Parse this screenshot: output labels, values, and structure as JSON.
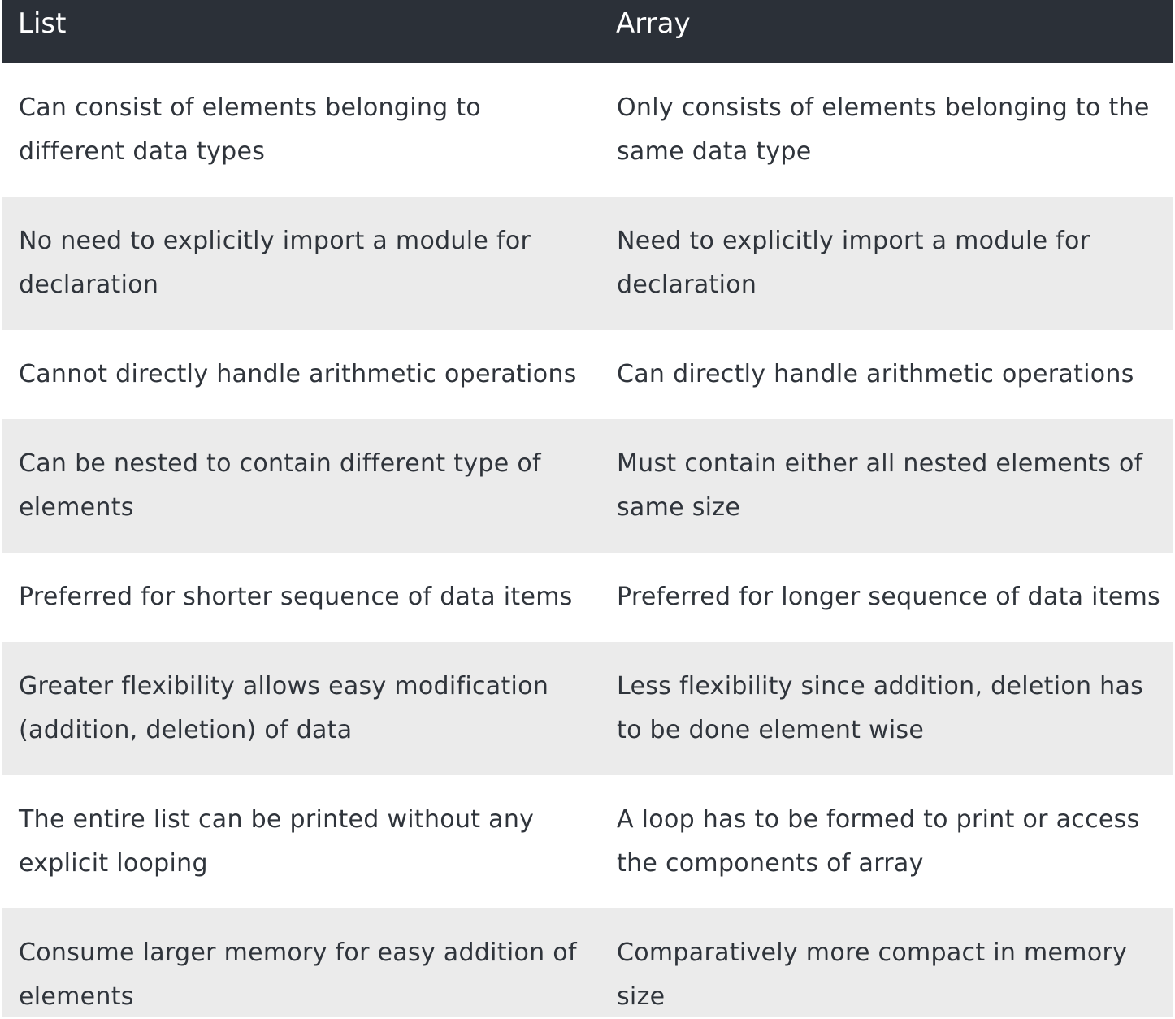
{
  "table": {
    "headers": [
      "List",
      "Array"
    ],
    "rows": [
      {
        "list": "Can consist of elements belonging to different data types",
        "array": "Only consists of elements belonging to the same data type"
      },
      {
        "list": "No need to explicitly import a module for declaration",
        "array": "Need to explicitly import a module for declaration"
      },
      {
        "list": "Cannot directly handle arithmetic operations",
        "array": "Can directly handle arithmetic operations"
      },
      {
        "list": "Can be nested to contain different type of elements",
        "array": "Must contain either all nested elements of same size"
      },
      {
        "list": "Preferred for shorter sequence of data items",
        "array": "Preferred for longer sequence of data items"
      },
      {
        "list": "Greater flexibility allows easy modification (addition, deletion) of data",
        "array": "Less flexibility since addition, deletion has to be done element wise"
      },
      {
        "list": "The entire list can be printed without any explicit looping",
        "array": "A loop has to be formed to print or access the components of array"
      },
      {
        "list": "Consume larger memory for easy addition of elements",
        "array": "Comparatively more compact in memory size"
      }
    ]
  },
  "colors": {
    "header_bg": "#2b3038",
    "header_text": "#ffffff",
    "row_alt_bg": "#ebebeb",
    "row_bg": "#ffffff",
    "text": "#2f343b"
  }
}
